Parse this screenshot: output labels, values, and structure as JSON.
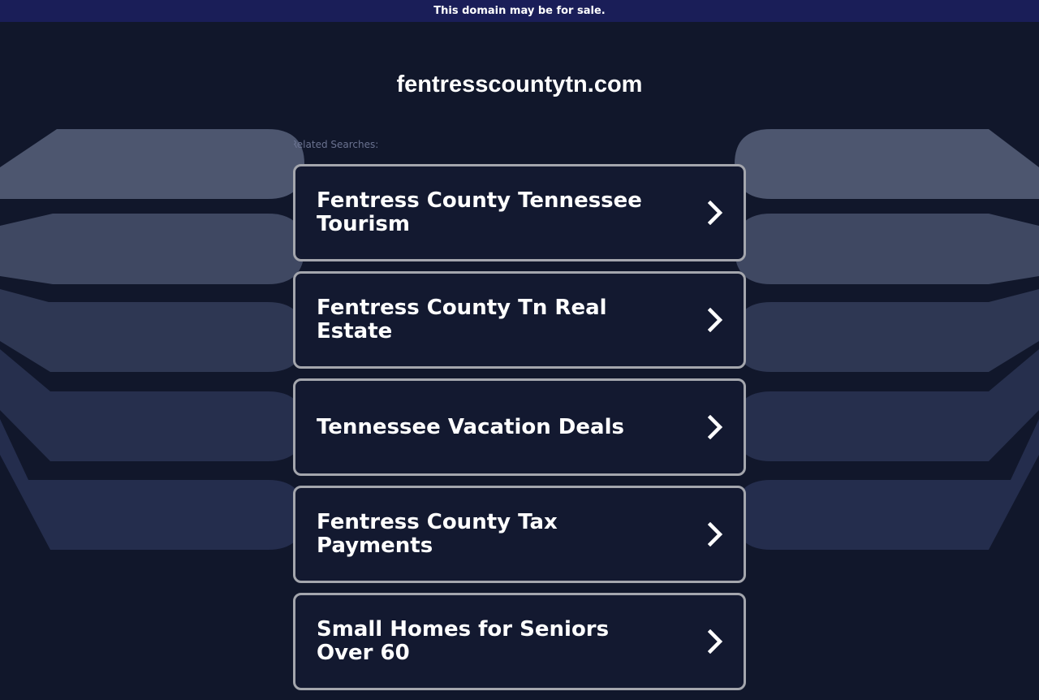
{
  "banner": {
    "text": "This domain may be for sale."
  },
  "domain": {
    "name": "fentresscountytn.com"
  },
  "related": {
    "label": "Related Searches:",
    "items": [
      {
        "label": "Fentress County Tennessee Tourism"
      },
      {
        "label": "Fentress County Tn Real Estate"
      },
      {
        "label": "Tennessee Vacation Deals"
      },
      {
        "label": "Fentress County Tax Payments"
      },
      {
        "label": "Small Homes for Seniors Over 60"
      }
    ]
  },
  "colors": {
    "background": "#11172b",
    "banner": "#1a1e58",
    "card_border": "#a4a6ad",
    "card_background": "#131930",
    "accent_shapes": [
      "#4d566f",
      "#3f4862",
      "#2e3753",
      "#262f4d",
      "#242d4d"
    ]
  },
  "icons": {
    "result_arrow": "chevron-right-icon"
  }
}
